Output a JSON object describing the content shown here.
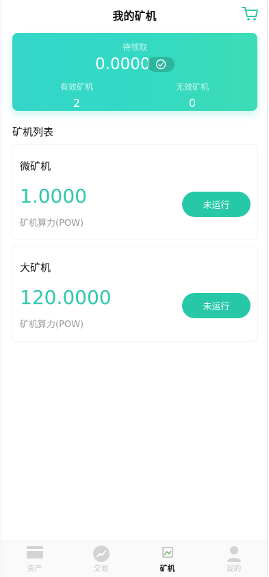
{
  "header": {
    "title": "我的矿机",
    "cart_icon": "cart-icon"
  },
  "summary": {
    "pending_label": "待领取",
    "pending_value": "0.0000",
    "valid_label": "有效矿机",
    "valid_count": "2",
    "invalid_label": "无效矿机",
    "invalid_count": "0"
  },
  "list": {
    "title": "矿机列表",
    "items": [
      {
        "name": "微矿机",
        "power": "1.0000",
        "power_label": "矿机算力(POW)",
        "status": "未运行"
      },
      {
        "name": "大矿机",
        "power": "120.0000",
        "power_label": "矿机算力(POW)",
        "status": "未运行"
      }
    ]
  },
  "tabbar": {
    "items": [
      {
        "label": "资产",
        "icon": "card-icon"
      },
      {
        "label": "交易",
        "icon": "chart-icon"
      },
      {
        "label": "矿机",
        "icon": "broken-image-icon"
      },
      {
        "label": "我的",
        "icon": "user-icon"
      }
    ],
    "active": "矿机"
  },
  "colors": {
    "accent": "#27c8a8",
    "power_text": "#2ec7ad",
    "gradient_start": "#35d6c9",
    "gradient_end": "#3ddcb6"
  }
}
